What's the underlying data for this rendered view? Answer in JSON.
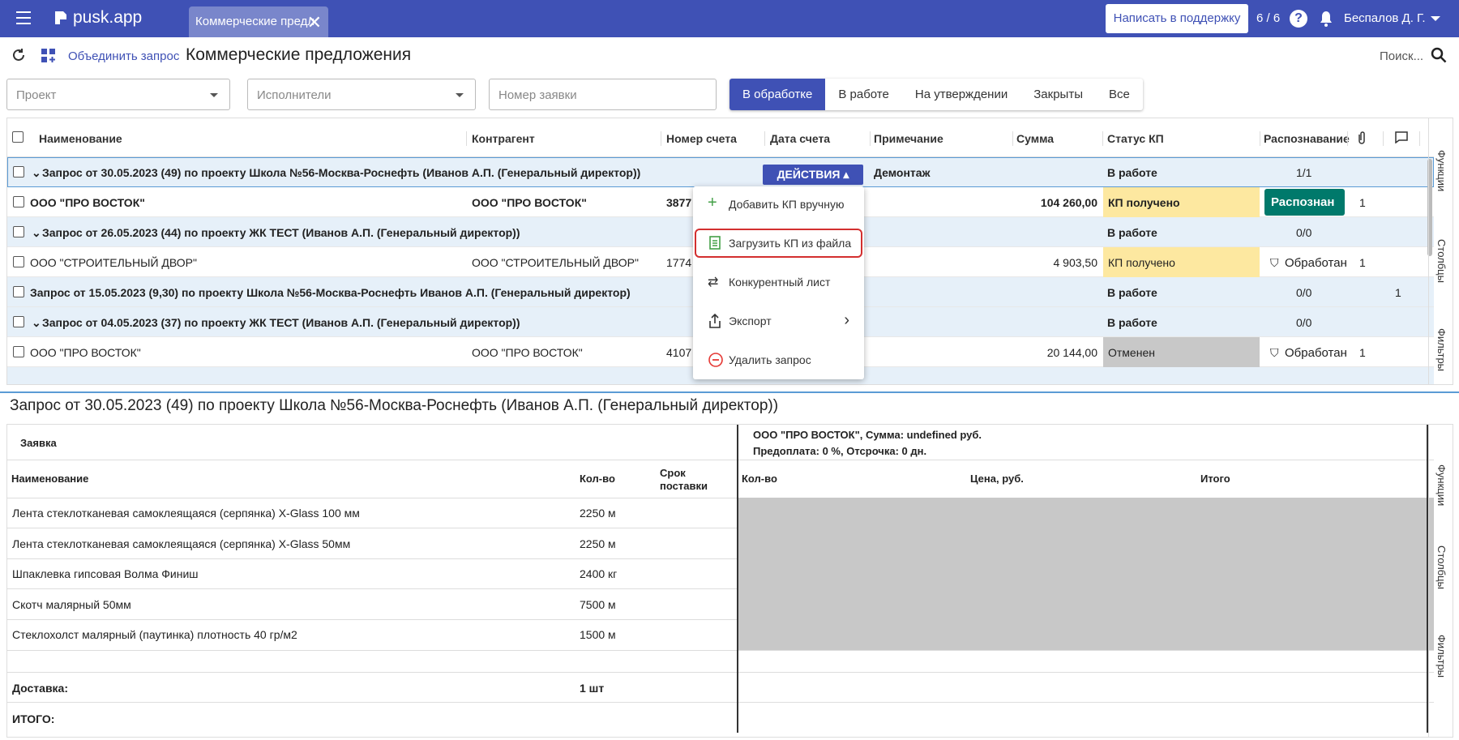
{
  "header": {
    "logo": "pusk.app",
    "tab_label": "Коммерческие предл",
    "support_label": "Написать в поддержку",
    "counter": "6 / 6",
    "help": "?",
    "user": "Беспалов Д. Г."
  },
  "toolbar": {
    "merge_label": "Объединить запрос",
    "page_title": "Коммерческие предложения",
    "search_label": "Поиск..."
  },
  "filters": {
    "project": "Проект",
    "executors": "Исполнители",
    "order_number": "Номер заявки"
  },
  "status_tabs": [
    "В обработке",
    "В работе",
    "На утверждении",
    "Закрыты",
    "Все"
  ],
  "grid": {
    "columns": [
      "Наименование",
      "Контрагент",
      "Номер счета",
      "Дата счета",
      "Примечание",
      "Сумма",
      "Статус КП",
      "Распознавание"
    ],
    "rows": [
      {
        "name": "Запрос от 30.05.2023 (49) по проекту Школа №56-Москва-Роснефть (Иванов А.П. (Генеральный директор))",
        "note": "Демонтаж",
        "status": "В работе",
        "recog": "1/1"
      },
      {
        "name": "ООО \"ПРО ВОСТОК\"",
        "contractor": "ООО \"ПРО ВОСТОК\"",
        "invoice": "3877",
        "sum": "104 260,00",
        "status": "КП получено",
        "recog": "Распознан",
        "clips": "1"
      },
      {
        "name": "Запрос от 26.05.2023 (44) по проекту ЖК ТЕСТ (Иванов А.П. (Генеральный директор))",
        "status": "В работе",
        "recog": "0/0"
      },
      {
        "name": "ООО \"СТРОИТЕЛЬНЫЙ ДВОР\"",
        "contractor": "ООО \"СТРОИТЕЛЬНЫЙ ДВОР\"",
        "invoice": "1774",
        "sum": "4 903,50",
        "status": "КП получено",
        "recog": "Обработан",
        "clips": "1"
      },
      {
        "name": "Запрос от 15.05.2023 (9,30) по проекту Школа №56-Москва-Роснефть Иванов А.П. (Генеральный директор)",
        "status": "В работе",
        "recog": "0/0",
        "comments": "1"
      },
      {
        "name": "Запрос от 04.05.2023 (37) по проекту ЖК ТЕСТ (Иванов А.П. (Генеральный директор))",
        "status": "В работе",
        "recog": "0/0"
      },
      {
        "name": "ООО \"ПРО ВОСТОК\"",
        "contractor": "ООО \"ПРО ВОСТОК\"",
        "invoice": "4107",
        "sum": "20 144,00",
        "status": "Отменен",
        "recog": "Обработан",
        "clips": "1"
      }
    ],
    "actions_label": "ДЕЙСТВИЯ"
  },
  "menu": [
    "Добавить КП вручную",
    "Загрузить КП из файла",
    "Конкурентный лист",
    "Экспорт",
    "Удалить запрос"
  ],
  "side_panel": [
    "Функции",
    "Столбцы",
    "Фильтры"
  ],
  "detail": {
    "title": "Запрос от 30.05.2023 (49) по проекту Школа №56-Москва-Роснефть (Иванов А.П. (Генеральный директор))",
    "request_label": "Заявка",
    "supplier_line1": "ООО \"ПРО ВОСТОК\", Сумма: undefined руб.",
    "supplier_line2": "Предоплата: 0 %, Отсрочка: 0 дн.",
    "col_name": "Наименование",
    "col_qty": "Кол-во",
    "col_term": "Срок поставки",
    "col_qty2": "Кол-во",
    "col_price": "Цена, руб.",
    "col_total": "Итого",
    "items": [
      {
        "name": "Лента стеклотканевая самоклеящаяся (серпянка) X-Glass 100 мм",
        "qty": "2250 м"
      },
      {
        "name": "Лента стеклотканевая самоклеящаяся (серпянка) X-Glass 50мм",
        "qty": "2250 м"
      },
      {
        "name": "Шпаклевка гипсовая Волма Финиш",
        "qty": "2400 кг"
      },
      {
        "name": "Скотч малярный 50мм",
        "qty": "7500 м"
      },
      {
        "name": "Стеклохолст малярный (паутинка) плотность 40 гр/м2",
        "qty": "1500 м"
      }
    ],
    "delivery_label": "Доставка:",
    "delivery_qty": "1 шт",
    "total_label": "ИТОГО:"
  },
  "colors": {
    "primary": "#3f51b5",
    "green": "#00796b",
    "yellow": "#fde8a0",
    "group_bg": "#e6f0f9"
  }
}
